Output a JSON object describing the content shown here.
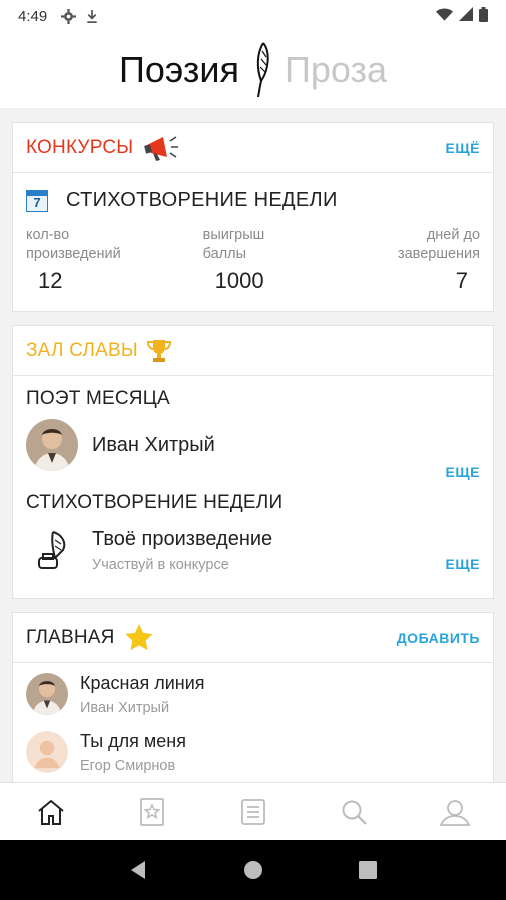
{
  "status_bar": {
    "time": "4:49"
  },
  "header": {
    "tab_poetry": "Поэзия",
    "tab_prose": "Проза"
  },
  "contests": {
    "title": "КОНКУРСЫ",
    "more": "ЕЩЁ",
    "calendar_day": "7",
    "contest_name": "СТИХОТВОРЕНИЕ НЕДЕЛИ",
    "stats": [
      {
        "label": "кол-во произведений",
        "value": "12"
      },
      {
        "label": "выигрыш баллы",
        "value": "1000"
      },
      {
        "label": "дней до завершения",
        "value": "7"
      }
    ]
  },
  "hall_of_fame": {
    "title": "ЗАЛ СЛАВЫ",
    "poet_label": "ПОЭТ МЕСЯЦА",
    "poet_name": "Иван Хитрый",
    "poet_more": "ЕЩЕ",
    "poem_label": "СТИХОТВОРЕНИЕ НЕДЕЛИ",
    "poem_title": "Твоё произведение",
    "poem_sub": "Участвуй в конкурсе",
    "poem_more": "ЕЩЕ"
  },
  "main": {
    "title": "ГЛАВНАЯ",
    "add": "ДОБАВИТЬ",
    "items": [
      {
        "title": "Красная линия",
        "author": "Иван Хитрый"
      },
      {
        "title": "Ты для меня",
        "author": "Егор Смирнов"
      }
    ]
  },
  "bottom_nav": [
    "home-icon",
    "favorites-icon",
    "list-icon",
    "search-icon",
    "profile-icon"
  ],
  "colors": {
    "contests": "#e5371d",
    "hall": "#f2b21e",
    "link": "#2aa3d9",
    "star": "#f5c518"
  }
}
